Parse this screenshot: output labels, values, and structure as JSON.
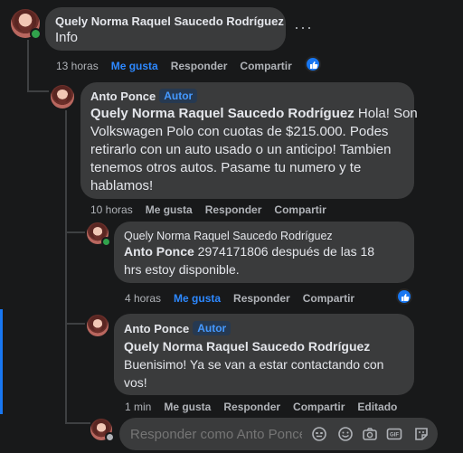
{
  "comment1": {
    "author": "Quely Norma Raquel Saucedo Rodríguez",
    "text": "Info",
    "time": "13 horas",
    "like": "Me gusta",
    "reply": "Responder",
    "share": "Compartir",
    "more": "···"
  },
  "comment2": {
    "author": "Anto Ponce",
    "badge": "Autor",
    "mention": "Quely Norma Raquel Saucedo Rodríguez",
    "text_line1": " Hola! Son",
    "text_line2": "Volkswagen Polo con cuotas de $215.000. Podes",
    "text_line3": "retirarlo con un auto usado o un anticipo! Tambien",
    "text_line4": "tenemos otros autos. Pasame tu numero y te",
    "text_line5": "hablamos!",
    "time": "10 horas",
    "like": "Me gusta",
    "reply": "Responder",
    "share": "Compartir"
  },
  "comment3": {
    "author": "Quely Norma Raquel Saucedo Rodríguez",
    "mention": "Anto Ponce",
    "text_line1": " 2974171806 después de las 18",
    "text_line2": "hrs estoy disponible.",
    "time": "4 horas",
    "like": "Me gusta",
    "reply": "Responder",
    "share": "Compartir"
  },
  "comment4": {
    "author": "Anto Ponce",
    "badge": "Autor",
    "mention": "Quely Norma Raquel Saucedo Rodríguez",
    "text_line1": "Buenisimo! Ya se van a estar contactando con",
    "text_line2": "vos!",
    "time": "1 min",
    "like": "Me gusta",
    "reply": "Responder",
    "share": "Compartir",
    "edited": "Editado"
  },
  "reply_box": {
    "placeholder": "Responder como Anto Ponce"
  },
  "icons": [
    "avatar-icon",
    "like-reaction-icon",
    "emoji-icon",
    "smiley-icon",
    "camera-icon",
    "gif-icon",
    "sticker-icon"
  ],
  "colors": {
    "link_blue": "#2d88ff",
    "bubble": "#3a3b3c",
    "background": "#18191a",
    "online_green": "#31a24c"
  }
}
